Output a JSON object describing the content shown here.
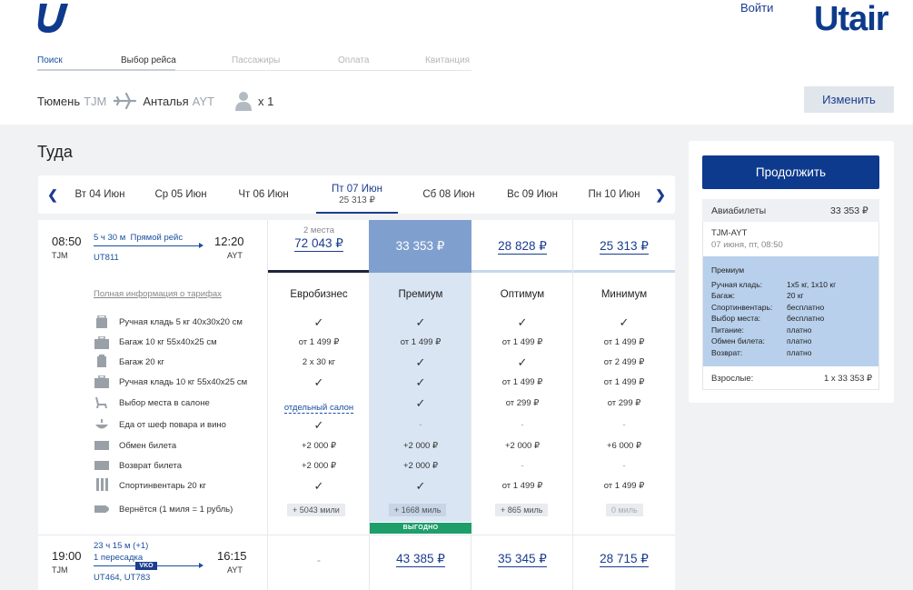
{
  "header": {
    "login": "Войти",
    "brand": "Utair",
    "steps": [
      "Поиск",
      "Выбор рейса",
      "Пассажиры",
      "Оплата",
      "Квитанция"
    ]
  },
  "route": {
    "from_city": "Тюмень",
    "from_code": "TJM",
    "to_city": "Анталья",
    "to_code": "AYT",
    "passengers": "x 1",
    "change_label": "Изменить"
  },
  "section_title": "Туда",
  "dates": [
    {
      "label": "Вт 04 Июн",
      "price": ""
    },
    {
      "label": "Ср 05 Июн",
      "price": ""
    },
    {
      "label": "Чт 06 Июн",
      "price": ""
    },
    {
      "label": "Пт 07 Июн",
      "price": "25 313 ₽"
    },
    {
      "label": "Сб 08 Июн",
      "price": ""
    },
    {
      "label": "Вс 09 Июн",
      "price": ""
    },
    {
      "label": "Пн 10 Июн",
      "price": ""
    }
  ],
  "flight1": {
    "dep_time": "08:50",
    "dep_code": "TJM",
    "duration": "5 ч 30 м",
    "type": "Прямой рейс",
    "arr_time": "12:20",
    "arr_code": "AYT",
    "flight_no": "UT811",
    "seats_note": "2 места",
    "prices": [
      "72 043 ₽",
      "33 353 ₽",
      "28 828 ₽",
      "25 313 ₽"
    ]
  },
  "fares": {
    "info_link": "Полная информация о тарифах",
    "names": [
      "Евробизнес",
      "Премиум",
      "Оптимум",
      "Минимум"
    ],
    "features": [
      {
        "label": "Ручная кладь 5 кг 40х30х20 см",
        "values": [
          "✓",
          "✓",
          "✓",
          "✓"
        ]
      },
      {
        "label": "Багаж 10 кг 55х40х25 см",
        "values": [
          "от 1 499 ₽",
          "от 1 499 ₽",
          "от 1 499 ₽",
          "от 1 499 ₽"
        ]
      },
      {
        "label": "Багаж 20 кг",
        "values": [
          "2 х 30 кг",
          "✓",
          "✓",
          "от 2 499 ₽"
        ]
      },
      {
        "label": "Ручная кладь 10 кг 55х40х25 см",
        "values": [
          "✓",
          "✓",
          "от 1 499 ₽",
          "от 1 499 ₽"
        ]
      },
      {
        "label": "Выбор места в салоне",
        "values": [
          "отдельный салон",
          "✓",
          "от 299 ₽",
          "от 299 ₽"
        ]
      },
      {
        "label": "Еда от шеф повара и вино",
        "values": [
          "✓",
          "-",
          "-",
          "-"
        ]
      },
      {
        "label": "Обмен билета",
        "values": [
          "+2 000 ₽",
          "+2 000 ₽",
          "+2 000 ₽",
          "+6 000 ₽"
        ]
      },
      {
        "label": "Возврат билета",
        "values": [
          "+2 000 ₽",
          "+2 000 ₽",
          "-",
          "-"
        ]
      },
      {
        "label": "Спортинвентарь 20 кг",
        "values": [
          "✓",
          "✓",
          "от 1 499 ₽",
          "от 1 499 ₽"
        ]
      },
      {
        "label": "Вернётся (1 миля = 1 рубль)",
        "values": [
          "+ 5043 мили",
          "+ 1668 миль",
          "+ 865 миль",
          "0 миль"
        ]
      }
    ],
    "best_badge": "ВЫГОДНО"
  },
  "flight2": {
    "dep_time": "19:00",
    "dep_code": "TJM",
    "duration": "23 ч 15 м (+1)",
    "type": "1 пересадка",
    "via": "VKO",
    "arr_time": "16:15",
    "arr_code": "AYT",
    "flight_no": "UT464, UT783",
    "prices": [
      "-",
      "43 385 ₽",
      "35 345 ₽",
      "28 715 ₽"
    ]
  },
  "summary": {
    "continue_label": "Продолжить",
    "tickets_label": "Авиабилеты",
    "tickets_total": "33 353 ₽",
    "route": "TJM-AYT",
    "date": "07 июня, пт, 08:50",
    "fare": "Премиум",
    "details": [
      {
        "k": "Ручная кладь:",
        "v": "1х5 кг, 1х10 кг"
      },
      {
        "k": "Багаж:",
        "v": "20 кг"
      },
      {
        "k": "Спортинвентарь:",
        "v": "бесплатно"
      },
      {
        "k": "Выбор места:",
        "v": "бесплатно"
      },
      {
        "k": "Питание:",
        "v": "платно"
      },
      {
        "k": "Обмен билета:",
        "v": "платно"
      },
      {
        "k": "Возврат:",
        "v": "платно"
      }
    ],
    "adults_label": "Взрослые:",
    "adults_value": "1 х 33 353 ₽"
  },
  "colors": {
    "brand": "#0d3a8c",
    "premium_head": "#7f9fcf",
    "premium_col": "#d9e5f3",
    "best_badge": "#1e9e6b"
  }
}
